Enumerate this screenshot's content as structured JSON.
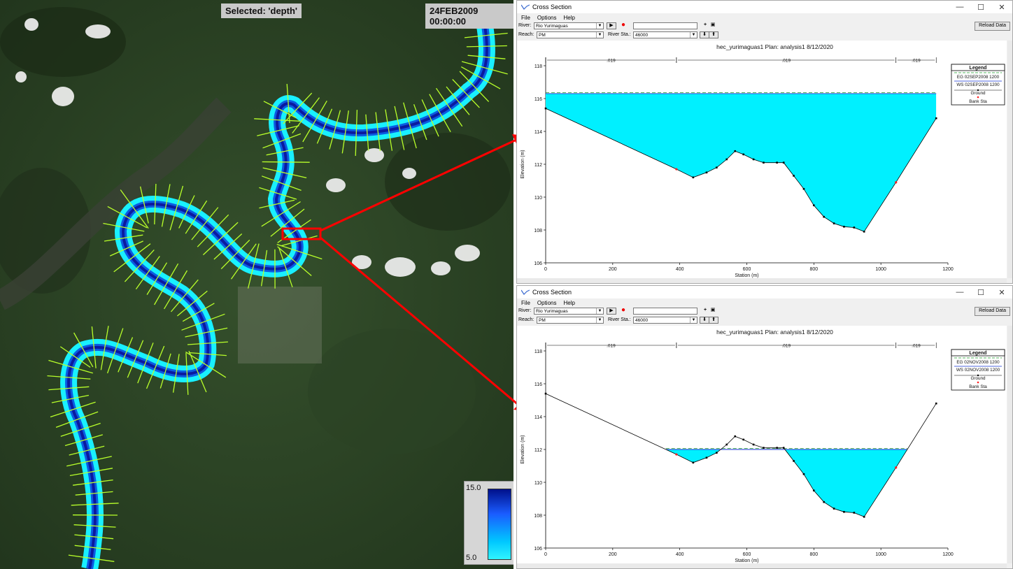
{
  "map": {
    "selected_label": "Selected: 'depth'",
    "timestamp": "24FEB2009 00:00:00",
    "depth_legend": {
      "max": "15.0",
      "min": "5.0"
    }
  },
  "windows": [
    {
      "title": "Cross Section",
      "menu": [
        "File",
        "Options",
        "Help"
      ],
      "river_label": "River:",
      "river_value": "Rio Yurimaguas",
      "reach_label": "Reach:",
      "reach_value": "PM",
      "river_sta_label": "River Sta.:",
      "river_sta_value": "46000",
      "reload_label": "Reload Data",
      "chart_data": {
        "type": "area",
        "title": "hec_yurimaguas1      Plan: analysis1     8/12/2020",
        "xlabel": "Station (m)",
        "ylabel": "Elevation (m)",
        "xlim": [
          0,
          1200
        ],
        "ylim": [
          106,
          118
        ],
        "x_ticks": [
          "0",
          "200",
          "400",
          "600",
          "800",
          "1000",
          "1200"
        ],
        "y_ticks": [
          "106",
          "108",
          "110",
          "112",
          "114",
          "116",
          "118"
        ],
        "manning": [
          ".019",
          ".019",
          ".019"
        ],
        "bank_stations": [
          390,
          1045
        ],
        "water_surface": 116.3,
        "energy_grade": 116.32,
        "ground": [
          [
            0,
            115.4
          ],
          [
            390,
            111.7
          ],
          [
            440,
            111.2
          ],
          [
            480,
            111.5
          ],
          [
            510,
            111.8
          ],
          [
            540,
            112.3
          ],
          [
            565,
            112.8
          ],
          [
            590,
            112.6
          ],
          [
            620,
            112.3
          ],
          [
            650,
            112.1
          ],
          [
            690,
            112.1
          ],
          [
            710,
            112.1
          ],
          [
            740,
            111.3
          ],
          [
            770,
            110.5
          ],
          [
            800,
            109.5
          ],
          [
            830,
            108.8
          ],
          [
            860,
            108.4
          ],
          [
            890,
            108.2
          ],
          [
            920,
            108.15
          ],
          [
            950,
            107.9
          ],
          [
            1045,
            110.9
          ],
          [
            1165,
            114.8
          ]
        ],
        "legend": [
          "EG 02SEP2008 1200",
          "WS 02SEP2008 1200",
          "Ground",
          "Bank Sta"
        ],
        "legend_title": "Legend"
      }
    },
    {
      "title": "Cross Section",
      "menu": [
        "File",
        "Options",
        "Help"
      ],
      "river_label": "River:",
      "river_value": "Rio Yurimaguas",
      "reach_label": "Reach:",
      "reach_value": "PM",
      "river_sta_label": "River Sta.:",
      "river_sta_value": "46000",
      "reload_label": "Reload Data",
      "chart_data": {
        "type": "area",
        "title": "hec_yurimaguas1      Plan: analysis1     8/12/2020",
        "xlabel": "Station (m)",
        "ylabel": "Elevation (m)",
        "xlim": [
          0,
          1200
        ],
        "ylim": [
          106,
          118
        ],
        "x_ticks": [
          "0",
          "200",
          "400",
          "600",
          "800",
          "1000",
          "1200"
        ],
        "y_ticks": [
          "106",
          "108",
          "110",
          "112",
          "114",
          "116",
          "118"
        ],
        "manning": [
          ".019",
          ".019",
          ".019"
        ],
        "bank_stations": [
          390,
          1045
        ],
        "water_surface": 112.0,
        "energy_grade": 112.02,
        "ground": [
          [
            0,
            115.4
          ],
          [
            390,
            111.7
          ],
          [
            440,
            111.2
          ],
          [
            480,
            111.5
          ],
          [
            510,
            111.8
          ],
          [
            540,
            112.3
          ],
          [
            565,
            112.8
          ],
          [
            590,
            112.6
          ],
          [
            620,
            112.3
          ],
          [
            650,
            112.1
          ],
          [
            690,
            112.1
          ],
          [
            710,
            112.1
          ],
          [
            740,
            111.3
          ],
          [
            770,
            110.5
          ],
          [
            800,
            109.5
          ],
          [
            830,
            108.8
          ],
          [
            860,
            108.4
          ],
          [
            890,
            108.2
          ],
          [
            920,
            108.15
          ],
          [
            950,
            107.9
          ],
          [
            1045,
            110.9
          ],
          [
            1165,
            114.8
          ]
        ],
        "legend": [
          "EG 02NOV2008 1200",
          "WS 02NOV2008 1200",
          "Ground",
          "Bank Sta"
        ],
        "legend_title": "Legend"
      }
    }
  ],
  "colors": {
    "water": "#00f0ff",
    "river": "#0033cc",
    "bank": "#ff2020",
    "eg": "#1a9a2a",
    "arrow": "#ff0000"
  }
}
